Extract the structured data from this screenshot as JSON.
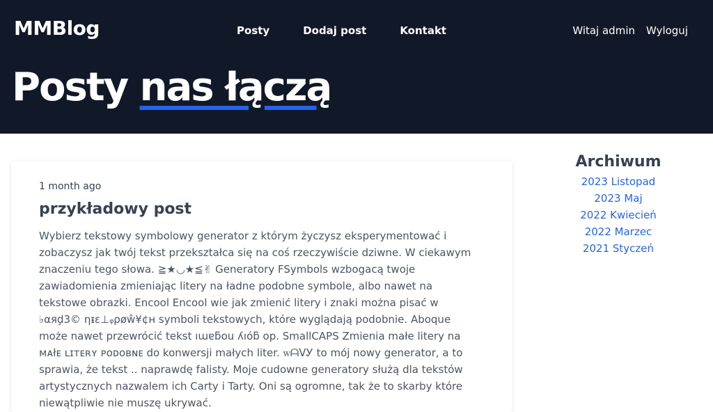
{
  "header": {
    "logo": "MMBlog",
    "nav": [
      {
        "label": "Posty"
      },
      {
        "label": "Dodaj post"
      },
      {
        "label": "Kontakt"
      }
    ],
    "greeting": "Witaj admin",
    "logout_label": "Wyloguj"
  },
  "hero": {
    "title_plain": "Posty ",
    "title_accent": "nas łączą"
  },
  "post": {
    "date": "1 month ago",
    "title": "przykładowy post",
    "body": "Wybierz tekstowy symbolowy generator z którym życzysz eksperymentować i zobaczysz jak twój tekst przekształca się na coś rzeczywiście dziwne. W ciekawym znaczeniu tego słowa. ≧★◡★≦✌ Generatory FSymbols wzbogacą twoje zawiadomienia zmieniając litery na ładne podobne symbole, albo nawet na tekstowe obrazki. Encool Encool wie jak zmienić litery i znaki można pisać w ♭αяḑ3© ηᵻε⊥ᵩρøŵ¥¢н symboli tekstowych, które wyglądają podobnie. Aboque może nawet przewrócić tekst ıɯɐƃou ʎıóƃ op. SmallCAPS Zmienia małe litery na ᴍᴀłᴇ ʟɪᴛᴇʀʏ ᴘᴏᴅᴏʙɴᴇ do konwersji małych liter. ꮃᗩᐯᎩ to mój nowy generator, a to sprawia, że tekst .. naprawdę falisty. Moje cudowne generatory służą dla tekstów artystycznych nazwalem ich Carty i Tarty. Oni są ogromne, tak że to skarby które niewątpliwie nie muszę ukrywać."
  },
  "archive": {
    "title": "Archiwum",
    "items": [
      {
        "label": "2023 Listopad"
      },
      {
        "label": "2023 Maj"
      },
      {
        "label": "2022 Kwiecień"
      },
      {
        "label": "2022 Marzec"
      },
      {
        "label": "2021 Styczeń"
      }
    ]
  },
  "colors": {
    "header_bg": "#111827",
    "accent": "#2563eb"
  }
}
